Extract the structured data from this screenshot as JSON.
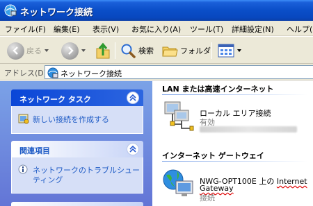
{
  "window": {
    "title": "ネットワーク接続"
  },
  "menu": {
    "items": [
      "ファイル(F)",
      "編集(E)",
      "表示(V)",
      "お気に入り(A)",
      "ツール(T)",
      "詳細設定(N)",
      "ヘルプ(H)"
    ]
  },
  "toolbar": {
    "back_label": "戻る",
    "search_label": "検索",
    "folders_label": "フォルダ"
  },
  "address": {
    "label": "アドレス(D)",
    "value": "ネットワーク接続"
  },
  "tasks": {
    "network_tasks": {
      "title": "ネットワーク タスク",
      "links": [
        "新しい接続を作成する"
      ]
    },
    "related": {
      "title": "関連項目",
      "links": [
        "ネットワークのトラブルシュー",
        "ティング"
      ]
    }
  },
  "content": {
    "lan_group": {
      "title": "LAN または高速インターネット",
      "items": [
        {
          "name": "ローカル エリア接続",
          "status": "有効"
        }
      ]
    },
    "gateway_group": {
      "title": "インターネット ゲートウェイ",
      "items": [
        {
          "name_part1": "NWG-OPT100E 上の ",
          "name_part2": "Internet",
          "name_part3": "Gateway",
          "status": "接続"
        }
      ]
    }
  }
}
